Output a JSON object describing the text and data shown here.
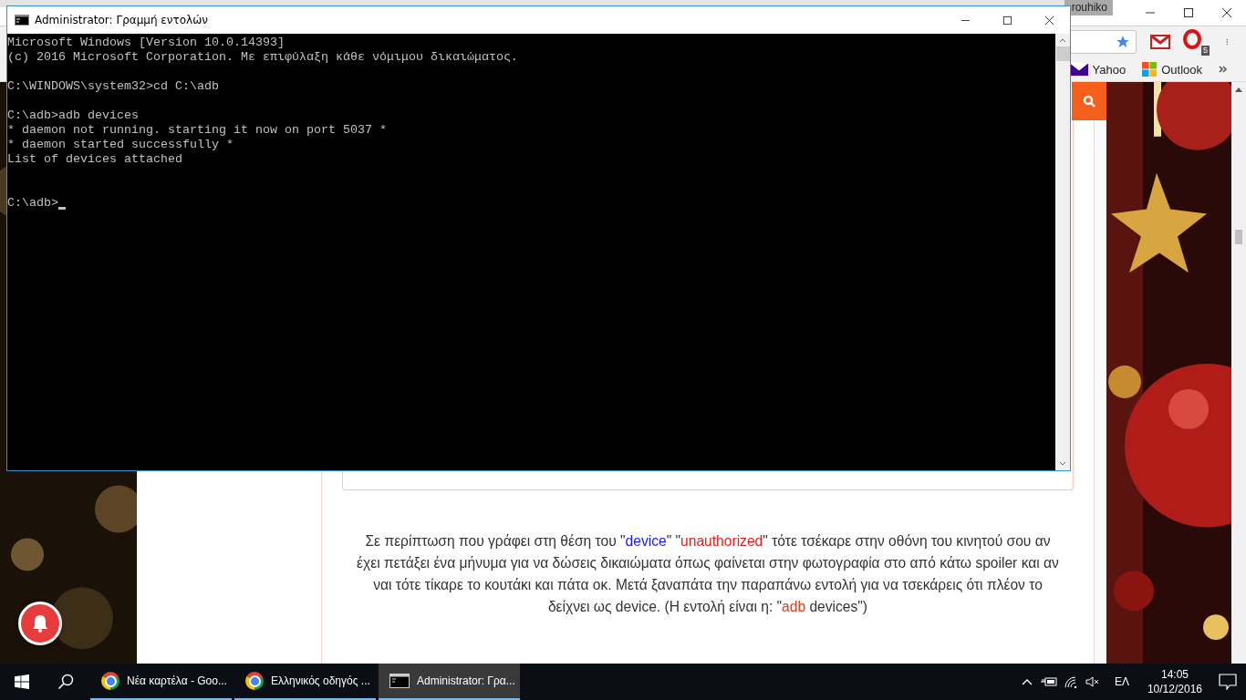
{
  "browser": {
    "profile_name": "rouhiko",
    "extension_badge": "5",
    "bookmarks": [
      {
        "label": "Yahoo",
        "kind": "envelope"
      },
      {
        "label": "Outlook",
        "kind": "squares"
      }
    ],
    "paragraph": [
      {
        "text": "Σε περίπτωση που γράφει στη θέση του \""
      },
      {
        "text": "device",
        "color": "#1a1aff"
      },
      {
        "text": "\" \""
      },
      {
        "text": "unauthorized",
        "color": "#e81c1c"
      },
      {
        "text": "\" τότε τσέκαρε στην οθόνη του κινητού σου αν έχει πετάξει ένα μήνυμα για να δώσεις δικαιώματα όπως φαίνεται στην φωτογραφία στο από κάτω spoiler και αν ναι τότε τίκαρε το κουτάκι και πάτα οκ. Μετά ξαναπάτα την παραπάνω εντολή για να τσεκάρεις ότι πλέον το δείχνει ως device. (Η εντολή είναι η: \""
      },
      {
        "text": "adb",
        "color": "#d9411e"
      },
      {
        "text": " devices\")"
      }
    ]
  },
  "console_window": {
    "title": "Administrator: Γραμμή εντολών",
    "blocks": [
      [
        "Microsoft Windows [Version 10.0.14393]",
        "(c) 2016 Microsoft Corporation. Με επιφύλαξη κάθε νόμιμου δικαιώματος."
      ],
      [
        "C:\\WINDOWS\\system32>cd C:\\adb"
      ],
      [
        "C:\\adb>adb devices",
        "* daemon not running. starting it now on port 5037 *",
        "* daemon started successfully *",
        "List of devices attached"
      ]
    ],
    "prompt": "C:\\adb>"
  },
  "taskbar": {
    "items": [
      {
        "label": "Νέα καρτέλα - Goo...",
        "kind": "browser",
        "selected": false
      },
      {
        "label": "Ελληνικός οδηγός ...",
        "kind": "browser",
        "selected": false
      },
      {
        "label": "Administrator: Γρα...",
        "kind": "console",
        "selected": true
      }
    ],
    "language": "ΕΛ",
    "time": "14:05",
    "date": "10/12/2016"
  }
}
